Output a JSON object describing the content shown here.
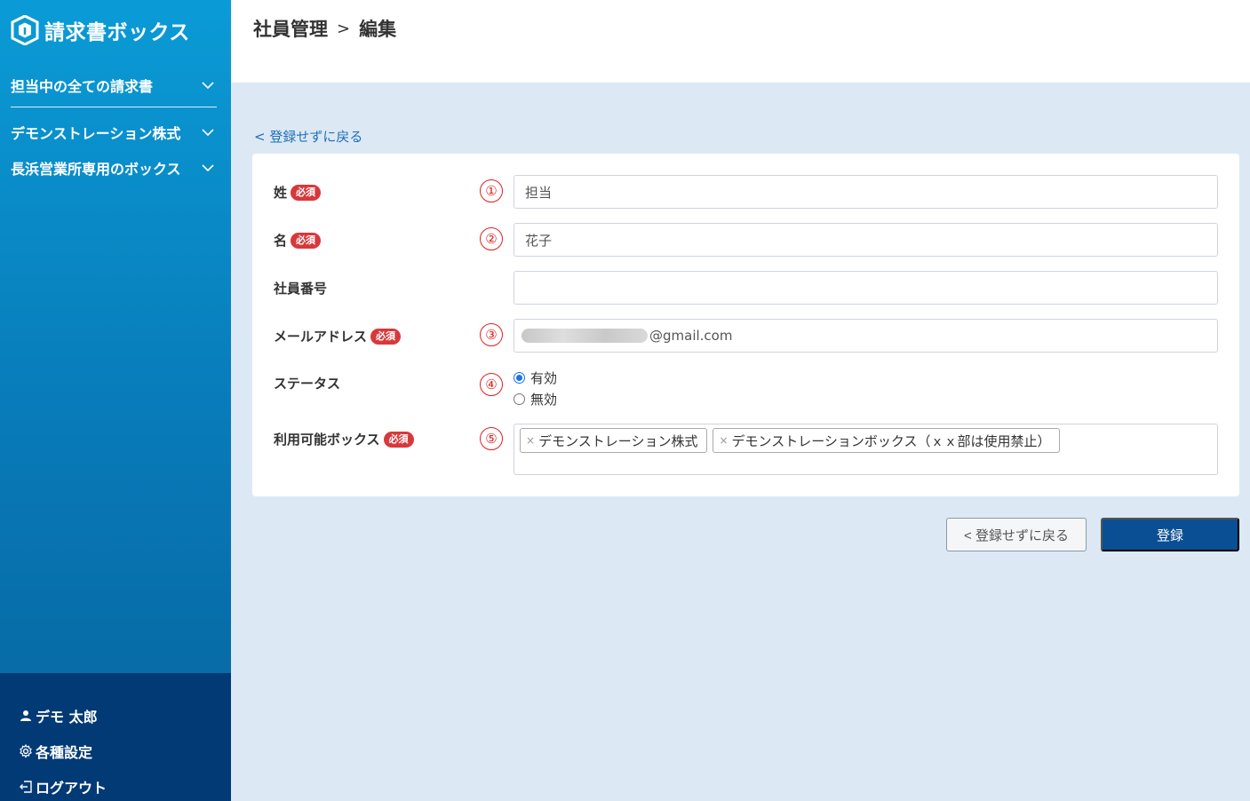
{
  "app": {
    "title": "請求書ボックス"
  },
  "sidebar": {
    "items": [
      {
        "label": "担当中の全ての請求書"
      },
      {
        "label": "デモンストレーション株式"
      },
      {
        "label": "長浜営業所専用のボックス"
      }
    ],
    "user_name": "デモ 太郎",
    "settings_label": "各種設定",
    "logout_label": "ログアウト"
  },
  "header": {
    "section": "社員管理",
    "separator": ">",
    "page": "編集"
  },
  "back_link": "< 登録せずに戻る",
  "form": {
    "required_badge": "必須",
    "last_name": {
      "label": "姓",
      "marker": "①",
      "value": "担当"
    },
    "first_name": {
      "label": "名",
      "marker": "②",
      "value": "花子"
    },
    "employee_no": {
      "label": "社員番号",
      "value": ""
    },
    "email": {
      "label": "メールアドレス",
      "marker": "③",
      "value_visible": "@gmail.com"
    },
    "status": {
      "label": "ステータス",
      "marker": "④",
      "options": [
        "有効",
        "無効"
      ],
      "selected": "有効"
    },
    "boxes": {
      "label": "利用可能ボックス",
      "marker": "⑤",
      "tags": [
        "デモンストレーション株式",
        "デモンストレーションボックス（ｘｘ部は使用禁止）"
      ]
    }
  },
  "buttons": {
    "back": "< 登録せずに戻る",
    "submit": "登録"
  },
  "colors": {
    "sidebar": "#0879b7",
    "sidebar_bottom": "#023a76",
    "primary": "#0a4f93",
    "required": "#d8383b",
    "marker": "#e02020"
  }
}
